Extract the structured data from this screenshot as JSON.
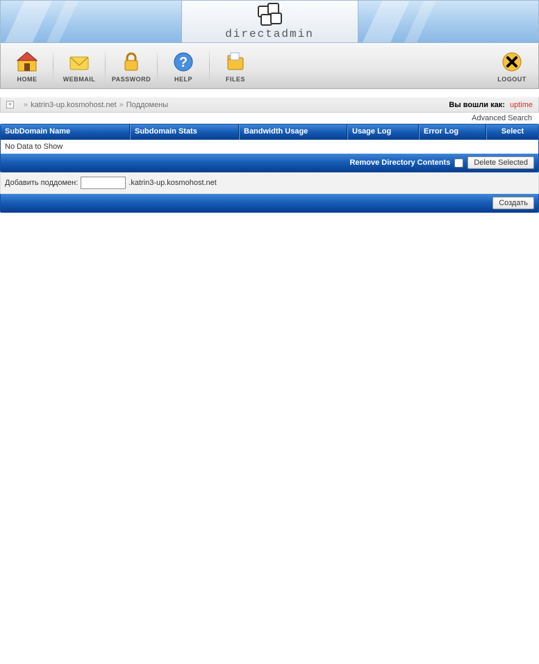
{
  "brand": "directadmin",
  "toolbar": {
    "home": "HOME",
    "webmail": "WEBMAIL",
    "password": "PASSWORD",
    "help": "HELP",
    "files": "FILES",
    "logout": "LOGOUT"
  },
  "breadcrumb": {
    "domain": "katrin3-up.kosmohost.net",
    "section": "Поддомены",
    "logged_in_label": "Вы вошли как:",
    "user": "uptime"
  },
  "advanced_search": "Advanced Search",
  "table": {
    "headers": {
      "name": "SubDomain Name",
      "stats": "Subdomain Stats",
      "bandwidth": "Bandwidth Usage",
      "usage": "Usage Log",
      "error": "Error Log",
      "select": "Select"
    },
    "no_data": "No Data to Show",
    "remove_label": "Remove Directory Contents",
    "delete_btn": "Delete Selected"
  },
  "form": {
    "add_label": "Добавить поддомен:",
    "domain_suffix": ".katrin3-up.kosmohost.net",
    "create_btn": "Создать"
  }
}
